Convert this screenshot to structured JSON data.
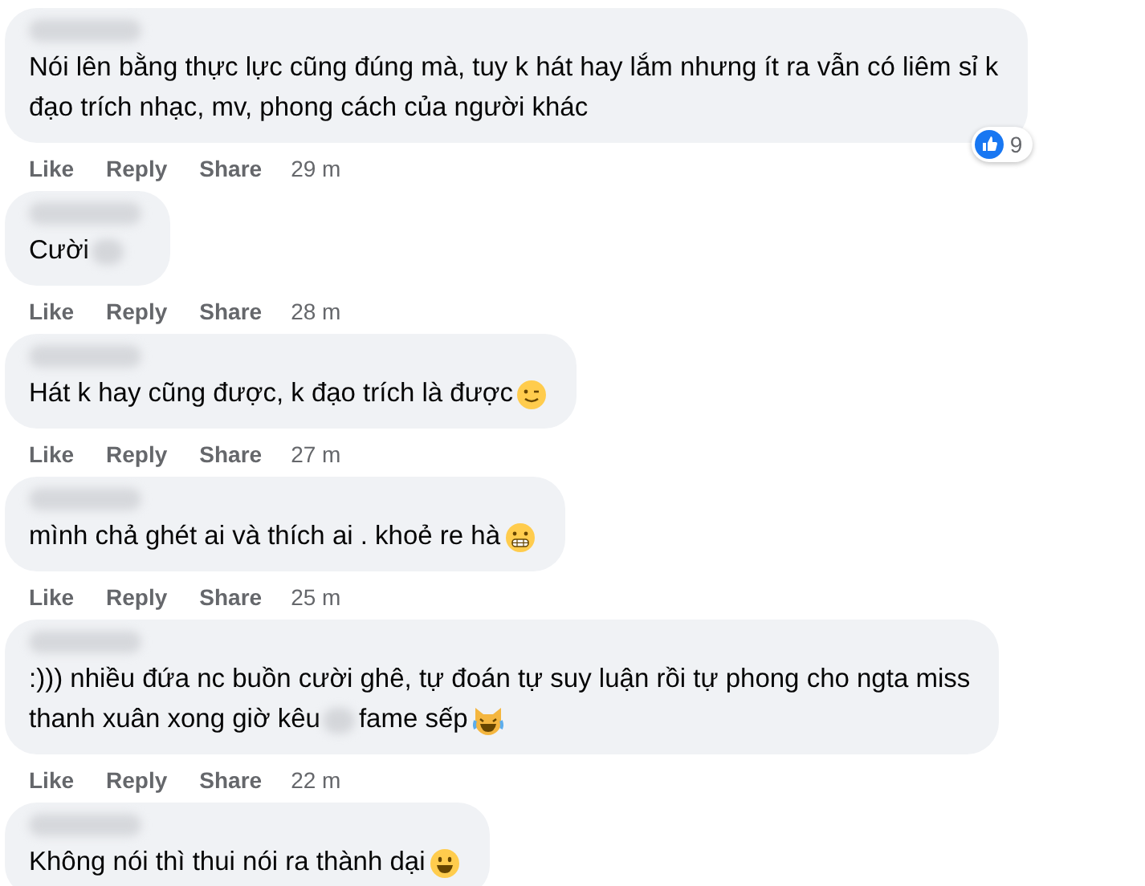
{
  "comments": [
    {
      "lines": [
        [
          {
            "kind": "text",
            "text": "Nói lên bằng thực lực cũng đúng mà, tuy k hát hay lắm nhưng ít ra vẫn có liêm sỉ k"
          }
        ],
        [
          {
            "kind": "text",
            "text": "đạo trích nhạc, mv, phong cách của người khác"
          }
        ]
      ],
      "actions": [
        "Like",
        "Reply",
        "Share"
      ],
      "time": "29 m",
      "reactions": "9"
    },
    {
      "lines": [
        [
          {
            "kind": "text",
            "text": "Cười"
          },
          {
            "kind": "blur"
          }
        ]
      ],
      "actions": [
        "Like",
        "Reply",
        "Share"
      ],
      "time": "28 m"
    },
    {
      "lines": [
        [
          {
            "kind": "text",
            "text": "Hát k hay cũng được, k đạo trích là được"
          },
          {
            "kind": "wink"
          }
        ]
      ],
      "actions": [
        "Like",
        "Reply",
        "Share"
      ],
      "time": "27 m"
    },
    {
      "lines": [
        [
          {
            "kind": "text",
            "text": "mình chả ghét ai và thích ai . khoẻ re hà "
          },
          {
            "kind": "grimace"
          }
        ]
      ],
      "actions": [
        "Like",
        "Reply",
        "Share"
      ],
      "time": "25 m"
    },
    {
      "lines": [
        [
          {
            "kind": "text",
            "text": ":))) nhiều đứa nc buồn cười ghê, tự đoán tự suy luận rồi tự phong cho ngta miss"
          }
        ],
        [
          {
            "kind": "text",
            "text": "thanh xuân xong giờ kêu"
          },
          {
            "kind": "blur"
          },
          {
            "kind": "text",
            "text": "fame sếp "
          },
          {
            "kind": "catlaugh"
          }
        ]
      ],
      "actions": [
        "Like",
        "Reply",
        "Share"
      ],
      "time": "22 m"
    },
    {
      "lines": [
        [
          {
            "kind": "text",
            "text": "Không nói thì thui nói ra thành dại"
          },
          {
            "kind": "smile"
          }
        ]
      ]
    }
  ]
}
